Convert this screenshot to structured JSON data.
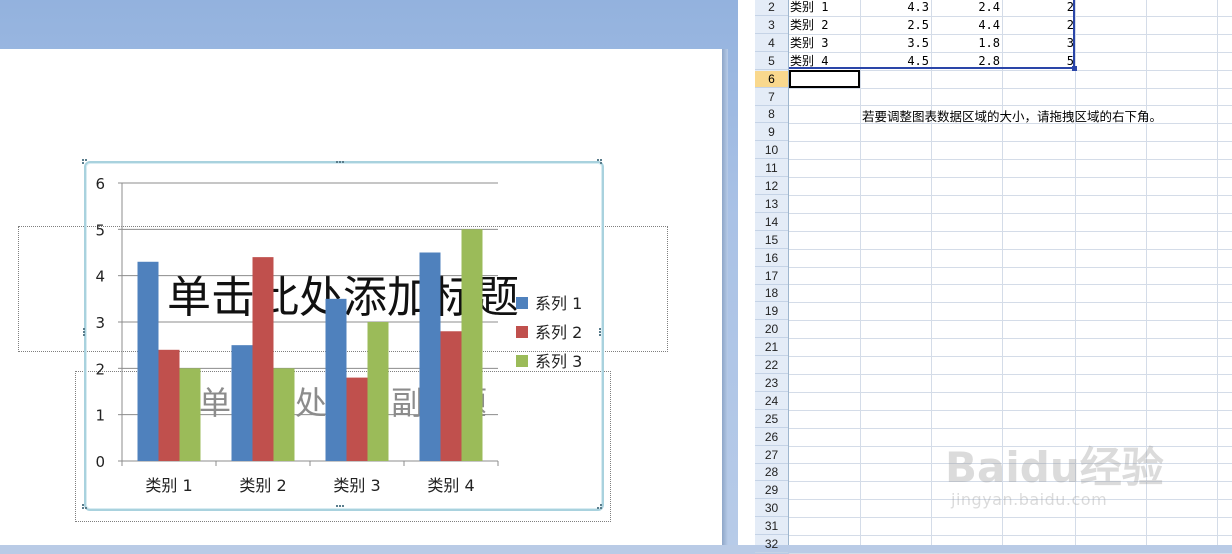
{
  "slide": {
    "title_placeholder": "单击此处添加标题",
    "subtitle_placeholder": "单击此处添加副标题"
  },
  "chart_data": {
    "type": "bar",
    "categories": [
      "类别 1",
      "类别 2",
      "类别 3",
      "类别 4"
    ],
    "series": [
      {
        "name": "系列 1",
        "values": [
          4.3,
          2.5,
          3.5,
          4.5
        ],
        "color": "#4f81bd"
      },
      {
        "name": "系列 2",
        "values": [
          2.4,
          4.4,
          1.8,
          2.8
        ],
        "color": "#c0504d"
      },
      {
        "name": "系列 3",
        "values": [
          2,
          2,
          3,
          5
        ],
        "color": "#9bbb59"
      }
    ],
    "ylim": [
      0,
      6
    ],
    "yticks": [
      "0",
      "1",
      "2",
      "3",
      "4",
      "5",
      "6"
    ],
    "grid": true,
    "legend": "right"
  },
  "sheet": {
    "rows": [
      {
        "num": "2",
        "label": "类别 1",
        "v1": "4.3",
        "v2": "2.4",
        "v3": "2"
      },
      {
        "num": "3",
        "label": "类别 2",
        "v1": "2.5",
        "v2": "4.4",
        "v3": "2"
      },
      {
        "num": "4",
        "label": "类别 3",
        "v1": "3.5",
        "v2": "1.8",
        "v3": "3"
      },
      {
        "num": "5",
        "label": "类别 4",
        "v1": "4.5",
        "v2": "2.8",
        "v3": "5"
      }
    ],
    "empty_rows": [
      "6",
      "7",
      "8",
      "9",
      "10",
      "11",
      "12",
      "13",
      "14",
      "15",
      "16",
      "17",
      "18",
      "19",
      "20",
      "21",
      "22",
      "23",
      "24",
      "25",
      "26",
      "27",
      "28",
      "29",
      "30",
      "31",
      "32"
    ],
    "active_row": "6",
    "hint": "若要调整图表数据区域的大小，请拖拽区域的右下角。"
  },
  "watermark": {
    "logo": "Baidu经验",
    "url": "jingyan.baidu.com"
  }
}
